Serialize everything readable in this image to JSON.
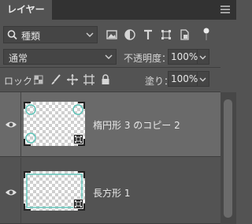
{
  "panel": {
    "tab_label": "レイヤー",
    "menu_icon": "hamburger-menu-icon"
  },
  "filter": {
    "kind_label": "種類",
    "icons": [
      "search-icon",
      "image-filter-icon",
      "adjustment-filter-icon",
      "text-filter-icon",
      "shape-filter-icon",
      "smart-object-filter-icon",
      "filter-toggle-icon"
    ]
  },
  "blend": {
    "mode_label": "通常",
    "opacity_label": "不透明度：",
    "opacity_value": "100%"
  },
  "lock": {
    "label": "ロック：",
    "icons": [
      "lock-transparent-icon",
      "lock-image-icon",
      "lock-position-icon",
      "lock-artboard-icon",
      "lock-all-icon"
    ],
    "fill_label": "塗り：",
    "fill_value": "100%"
  },
  "layers": [
    {
      "name": "楕円形 3 のコピー 2",
      "visible": true,
      "selected": true,
      "accent": "#5bc4b8"
    },
    {
      "name": "長方形 1",
      "visible": true,
      "selected": false,
      "accent": "#5bc4b8"
    }
  ]
}
